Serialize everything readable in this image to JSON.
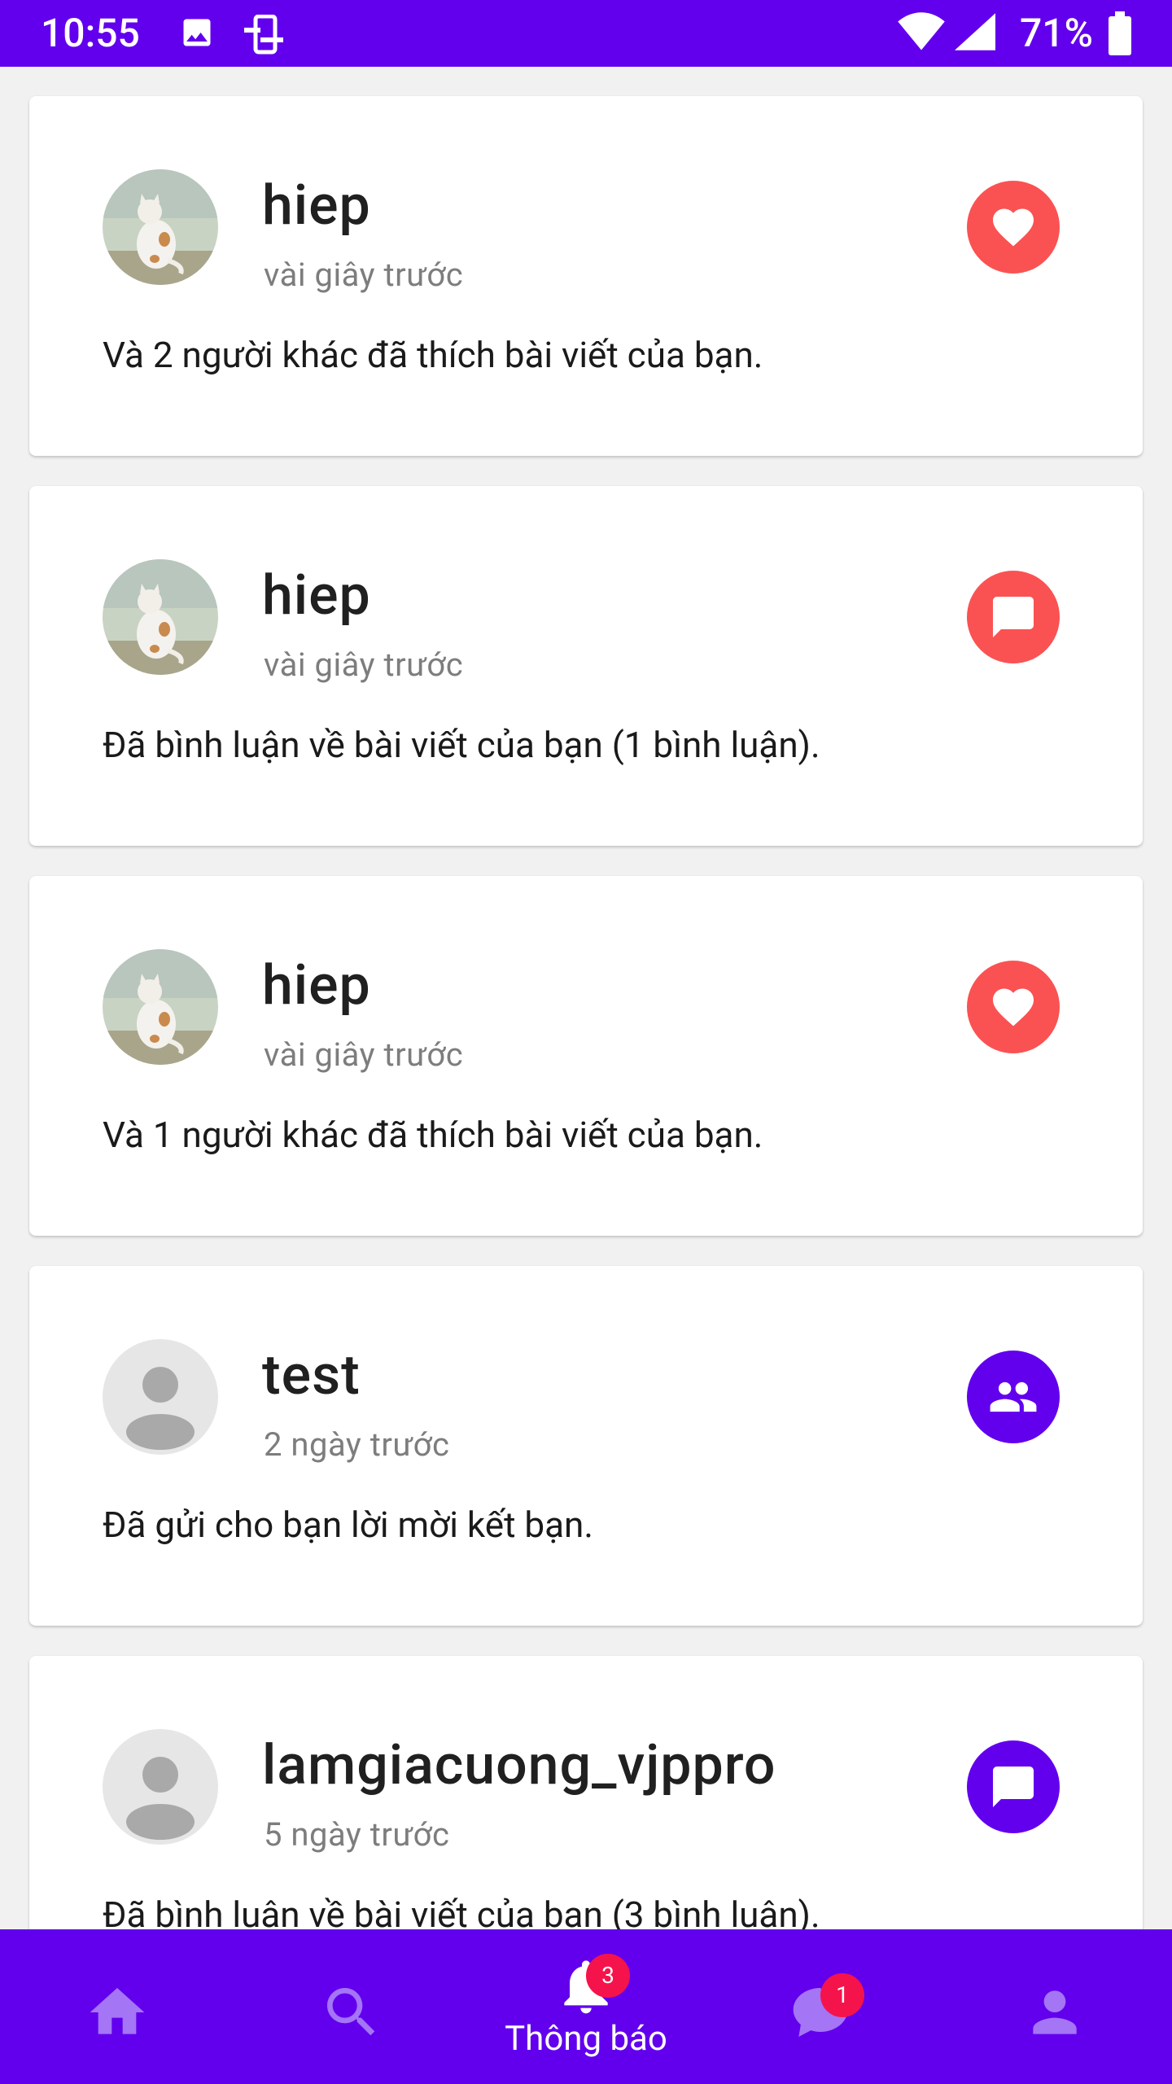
{
  "status_bar": {
    "time": "10:55",
    "battery": "71%",
    "icons": [
      "image-icon",
      "screencast-icon",
      "wifi-icon",
      "signal-icon",
      "battery-icon"
    ]
  },
  "notifications": [
    {
      "username": "hiep",
      "time": "vài giây trước",
      "message": "Và 2 người khác đã thích bài viết của bạn.",
      "type": "like",
      "avatar": "cat-photo"
    },
    {
      "username": "hiep",
      "time": "vài giây trước",
      "message": "Đã bình luận về bài viết của bạn (1 bình luận).",
      "type": "comment",
      "avatar": "cat-photo"
    },
    {
      "username": "hiep",
      "time": "vài giây trước",
      "message": "Và 1 người khác đã thích bài viết của bạn.",
      "type": "like",
      "avatar": "cat-photo"
    },
    {
      "username": "test",
      "time": "2 ngày trước",
      "message": "Đã gửi cho bạn lời mời kết bạn.",
      "type": "friend_request",
      "avatar": "default-person"
    },
    {
      "username": "lamgiacuong_vjppro",
      "time": "5 ngày trước",
      "message": "Đã bình luận về bài viết của bạn (3 bình luận).",
      "type": "comment",
      "avatar": "default-person"
    }
  ],
  "bottom_nav": {
    "items": [
      {
        "icon": "home-icon",
        "label": ""
      },
      {
        "icon": "search-icon",
        "label": ""
      },
      {
        "icon": "bell-icon",
        "label": "Thông báo",
        "badge": "3",
        "active": true
      },
      {
        "icon": "chat-icon",
        "label": "",
        "badge": "1"
      },
      {
        "icon": "person-icon",
        "label": ""
      }
    ]
  },
  "colors": {
    "primary": "#6200ee",
    "like_badge": "#fa5252",
    "comment_badge_recent": "#fa5252",
    "badge_purple": "#6200ee",
    "notification_badge": "#f5134b",
    "inactive_nav_icon": "#a475f5"
  }
}
